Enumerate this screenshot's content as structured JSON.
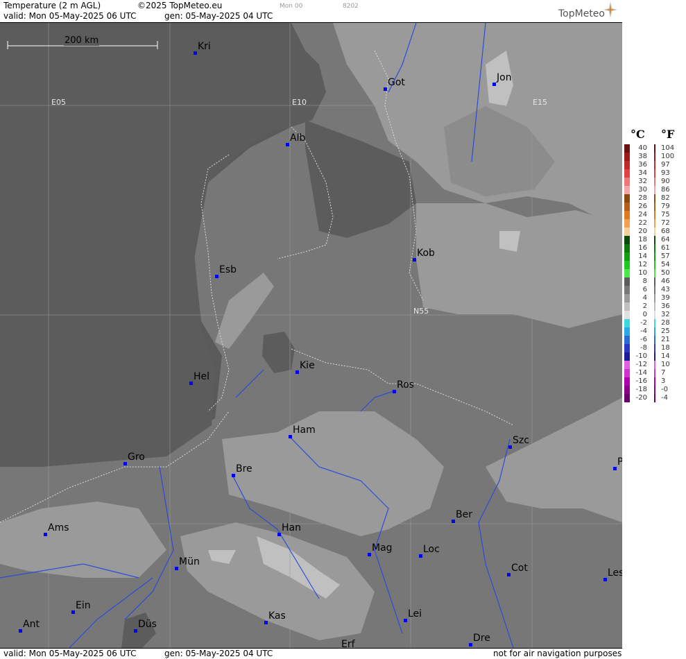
{
  "header": {
    "title": "Temperature (2 m AGL)",
    "copyright": "©2025 TopMeteo.eu",
    "run_label": "Mon 00",
    "run_code": "8202",
    "valid": "valid:  Mon  05-May-2025  06 UTC",
    "gen": "gen: 05-May-2025 04 UTC",
    "logo": "TopMeteo"
  },
  "footer": {
    "valid": "valid:  Mon  05-May-2025  06 UTC",
    "gen": "gen: 05-May-2025 04 UTC",
    "disclaimer": "not for air navigation purposes"
  },
  "map": {
    "scale_label": "200 km",
    "grid_labels": [
      "E05",
      "E10",
      "E15",
      "N55"
    ],
    "cities": [
      {
        "name": "Kri"
      },
      {
        "name": "Got"
      },
      {
        "name": "Jon"
      },
      {
        "name": "Alb"
      },
      {
        "name": "Kob"
      },
      {
        "name": "Esb"
      },
      {
        "name": "Kie"
      },
      {
        "name": "Hel"
      },
      {
        "name": "Ros"
      },
      {
        "name": "Ham"
      },
      {
        "name": "Szc"
      },
      {
        "name": "Gro"
      },
      {
        "name": "Bre"
      },
      {
        "name": "P"
      },
      {
        "name": "Ber"
      },
      {
        "name": "Ams"
      },
      {
        "name": "Han"
      },
      {
        "name": "Mag"
      },
      {
        "name": "Loc"
      },
      {
        "name": "Mün"
      },
      {
        "name": "Cot"
      },
      {
        "name": "Les"
      },
      {
        "name": "Ein"
      },
      {
        "name": "Kas"
      },
      {
        "name": "Lei"
      },
      {
        "name": "Ant"
      },
      {
        "name": "Düs"
      },
      {
        "name": "Dre"
      },
      {
        "name": "Erf"
      }
    ]
  },
  "legend": {
    "celsius_unit": "°C",
    "fahrenheit_unit": "°F",
    "celsius": [
      "40",
      "38",
      "36",
      "34",
      "32",
      "30",
      "28",
      "26",
      "24",
      "22",
      "20",
      "18",
      "16",
      "14",
      "12",
      "10",
      "8",
      "6",
      "4",
      "2",
      "0",
      "-2",
      "-4",
      "-6",
      "-8",
      "-10",
      "-12",
      "-14",
      "-16",
      "-18",
      "-20"
    ],
    "fahrenheit": [
      "104",
      "100",
      "97",
      "93",
      "90",
      "86",
      "82",
      "79",
      "75",
      "72",
      "68",
      "64",
      "61",
      "57",
      "54",
      "50",
      "46",
      "43",
      "39",
      "36",
      "32",
      "28",
      "25",
      "21",
      "18",
      "14",
      "10",
      "7",
      "3",
      "-0",
      "-4"
    ],
    "colors": [
      "#6b0f0f",
      "#9b1b1b",
      "#c02a2a",
      "#e04343",
      "#ee7777",
      "#f2a6a6",
      "#8b4a12",
      "#b45f17",
      "#e07a1e",
      "#f0a050",
      "#f5cf9a",
      "#0a4a0a",
      "#0d7a0d",
      "#12a012",
      "#1ec81e",
      "#4ae84a",
      "#5c5c5c",
      "#787878",
      "#9a9a9a",
      "#c0c0c0",
      "#e0e0e0",
      "#3ad9e0",
      "#2aa8e8",
      "#2a6ad9",
      "#2a38c8",
      "#1a1a9a",
      "#e060e0",
      "#d030d0",
      "#b000b0",
      "#8a008a",
      "#6a006a"
    ]
  }
}
